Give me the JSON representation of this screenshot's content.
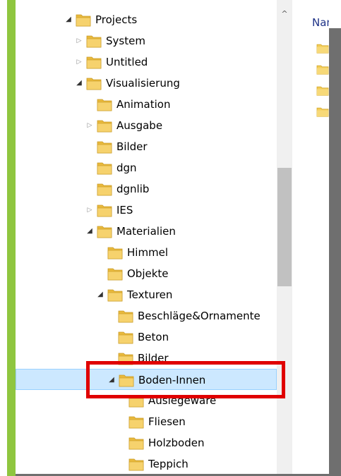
{
  "tree": {
    "nodes": [
      {
        "label": "Projects",
        "depth": 0,
        "expander": "open"
      },
      {
        "label": "System",
        "depth": 1,
        "expander": "closed"
      },
      {
        "label": "Untitled",
        "depth": 1,
        "expander": "closed"
      },
      {
        "label": "Visualisierung",
        "depth": 1,
        "expander": "open"
      },
      {
        "label": "Animation",
        "depth": 2,
        "expander": "none"
      },
      {
        "label": "Ausgabe",
        "depth": 2,
        "expander": "closed"
      },
      {
        "label": "Bilder",
        "depth": 2,
        "expander": "none"
      },
      {
        "label": "dgn",
        "depth": 2,
        "expander": "none"
      },
      {
        "label": "dgnlib",
        "depth": 2,
        "expander": "none"
      },
      {
        "label": "IES",
        "depth": 2,
        "expander": "closed"
      },
      {
        "label": "Materialien",
        "depth": 2,
        "expander": "open"
      },
      {
        "label": "Himmel",
        "depth": 3,
        "expander": "none"
      },
      {
        "label": "Objekte",
        "depth": 3,
        "expander": "none"
      },
      {
        "label": "Texturen",
        "depth": 3,
        "expander": "open"
      },
      {
        "label": "Beschläge&Ornamente",
        "depth": 4,
        "expander": "none"
      },
      {
        "label": "Beton",
        "depth": 4,
        "expander": "none"
      },
      {
        "label": "Bilder",
        "depth": 4,
        "expander": "none"
      },
      {
        "label": "Boden-Innen",
        "depth": 4,
        "expander": "open",
        "selected": true
      },
      {
        "label": "Auslegeware",
        "depth": 5,
        "expander": "none"
      },
      {
        "label": "Fliesen",
        "depth": 5,
        "expander": "none"
      },
      {
        "label": "Holzboden",
        "depth": 5,
        "expander": "none"
      },
      {
        "label": "Teppich",
        "depth": 5,
        "expander": "none"
      }
    ]
  },
  "scrollbar": {
    "up_arrow": "^"
  },
  "content_pane": {
    "column_header": "Name"
  },
  "colors": {
    "accent_bar": "#8fc63f",
    "selection_fill": "#cce8ff",
    "selection_border": "#99d1ff",
    "highlight_box": "#e00000",
    "folder_yellow": "#f3cd58"
  }
}
